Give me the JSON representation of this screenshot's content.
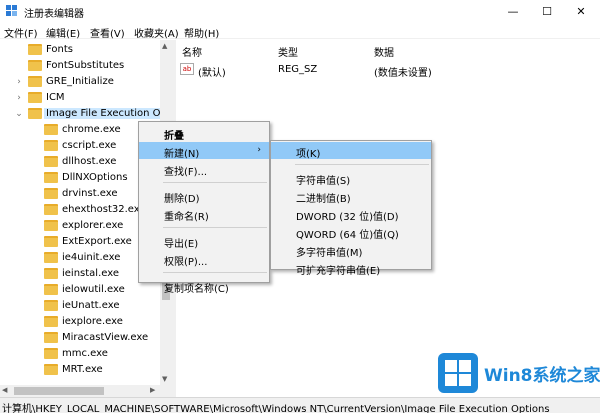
{
  "window": {
    "title": "注册表编辑器",
    "min_glyph": "—",
    "max_glyph": "☐",
    "close_glyph": "✕"
  },
  "menubar": {
    "items": [
      "文件(F)",
      "编辑(E)",
      "查看(V)",
      "收藏夹(A)",
      "帮助(H)"
    ]
  },
  "tree": {
    "items": [
      {
        "label": "Fonts",
        "expander": "",
        "indent": 1
      },
      {
        "label": "FontSubstitutes",
        "expander": "",
        "indent": 1
      },
      {
        "label": "GRE_Initialize",
        "expander": "›",
        "indent": 1
      },
      {
        "label": "ICM",
        "expander": "›",
        "indent": 1
      },
      {
        "label": "Image File Execution Op",
        "expander": "⌄",
        "indent": 1,
        "selected": true
      },
      {
        "label": "chrome.exe",
        "expander": "",
        "indent": 2
      },
      {
        "label": "cscript.exe",
        "expander": "",
        "indent": 2
      },
      {
        "label": "dllhost.exe",
        "expander": "",
        "indent": 2
      },
      {
        "label": "DllNXOptions",
        "expander": "",
        "indent": 2
      },
      {
        "label": "drvinst.exe",
        "expander": "",
        "indent": 2
      },
      {
        "label": "ehexthost32.exe",
        "expander": "",
        "indent": 2
      },
      {
        "label": "explorer.exe",
        "expander": "",
        "indent": 2
      },
      {
        "label": "ExtExport.exe",
        "expander": "",
        "indent": 2
      },
      {
        "label": "ie4uinit.exe",
        "expander": "",
        "indent": 2
      },
      {
        "label": "ieinstal.exe",
        "expander": "",
        "indent": 2
      },
      {
        "label": "ielowutil.exe",
        "expander": "",
        "indent": 2
      },
      {
        "label": "ieUnatt.exe",
        "expander": "",
        "indent": 2
      },
      {
        "label": "iexplore.exe",
        "expander": "",
        "indent": 2
      },
      {
        "label": "MiracastView.exe",
        "expander": "",
        "indent": 2
      },
      {
        "label": "mmc.exe",
        "expander": "",
        "indent": 2
      },
      {
        "label": "MRT.exe",
        "expander": "",
        "indent": 2
      }
    ]
  },
  "values_pane": {
    "columns": [
      "名称",
      "类型",
      "数据"
    ],
    "rows": [
      {
        "icon_text": "ab",
        "name": "(默认)",
        "type": "REG_SZ",
        "data": "(数值未设置)"
      }
    ]
  },
  "context_menu": {
    "items": [
      {
        "label": "折叠",
        "bold": true
      },
      {
        "label": "新建(N)",
        "submenu": true,
        "highlighted": true
      },
      {
        "label": "查找(F)..."
      },
      {
        "separator": true
      },
      {
        "label": "删除(D)"
      },
      {
        "label": "重命名(R)"
      },
      {
        "separator": true
      },
      {
        "label": "导出(E)"
      },
      {
        "label": "权限(P)..."
      },
      {
        "separator": true
      },
      {
        "label": "复制项名称(C)"
      }
    ],
    "submenu_arrow": "›"
  },
  "submenu": {
    "items": [
      {
        "label": "项(K)",
        "highlighted": true
      },
      {
        "separator": true
      },
      {
        "label": "字符串值(S)"
      },
      {
        "label": "二进制值(B)"
      },
      {
        "label": "DWORD (32 位)值(D)"
      },
      {
        "label": "QWORD (64 位)值(Q)"
      },
      {
        "label": "多字符串值(M)"
      },
      {
        "label": "可扩充字符串值(E)"
      }
    ]
  },
  "statusbar": {
    "path": "计算机\\HKEY_LOCAL_MACHINE\\SOFTWARE\\Microsoft\\Windows NT\\CurrentVersion\\Image File Execution Options"
  },
  "watermark": {
    "text": "Win8系统之家"
  },
  "colors": {
    "selection": "#cce8ff",
    "menu_highlight": "#91c9f7",
    "folder": "#f0c24b",
    "watermark_blue": "#1e88d8"
  }
}
